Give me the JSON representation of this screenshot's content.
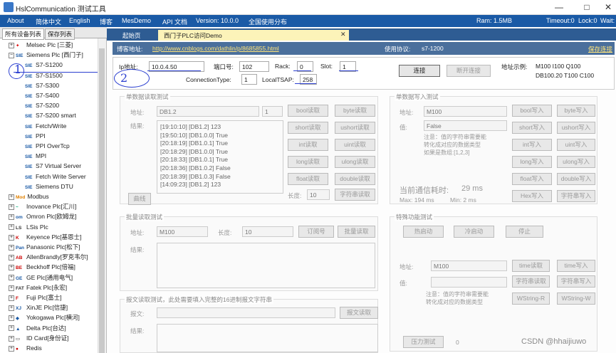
{
  "window": {
    "title": "HslCommunication 测试工具",
    "minimize": "—",
    "maximize": "□",
    "close": "✕"
  },
  "menu": {
    "items": [
      "About",
      "简体中文",
      "English",
      "博客",
      "MesDemo",
      "API 文档",
      "Version: 10.0.0",
      "全国使用分布"
    ],
    "ram": "Ram: 1.5MB",
    "timeout": "Timeout:0",
    "lock": "Lock:0",
    "wait": "Wait:"
  },
  "left_panel": {
    "tabs": [
      "所有设备列表",
      "保存列表"
    ],
    "tree": [
      {
        "icon": "mitsubishi-icon",
        "glyph": "✦",
        "label": "Melsec Plc [三菱]",
        "level": 0,
        "expander": "+"
      },
      {
        "icon": "siemens-icon",
        "glyph": "SIE",
        "label": "Siemens Plc [西门子]",
        "level": 0,
        "expander": "−"
      },
      {
        "icon": "siemens-icon",
        "glyph": "SIE",
        "label": "S7-S1200",
        "level": 1
      },
      {
        "icon": "siemens-icon",
        "glyph": "SIE",
        "label": "S7-S1500",
        "level": 1
      },
      {
        "icon": "siemens-icon",
        "glyph": "SIE",
        "label": "S7-S300",
        "level": 1
      },
      {
        "icon": "siemens-icon",
        "glyph": "SIE",
        "label": "S7-S400",
        "level": 1
      },
      {
        "icon": "siemens-icon",
        "glyph": "SIE",
        "label": "S7-S200",
        "level": 1
      },
      {
        "icon": "siemens-icon",
        "glyph": "SIE",
        "label": "S7-S200 smart",
        "level": 1
      },
      {
        "icon": "siemens-icon",
        "glyph": "SIE",
        "label": "Fetch/Write",
        "level": 1
      },
      {
        "icon": "siemens-icon",
        "glyph": "SIE",
        "label": "PPI",
        "level": 1
      },
      {
        "icon": "siemens-icon",
        "glyph": "SIE",
        "label": "PPI OverTcp",
        "level": 1
      },
      {
        "icon": "siemens-icon",
        "glyph": "SIE",
        "label": "MPI",
        "level": 1
      },
      {
        "icon": "siemens-icon",
        "glyph": "SIE",
        "label": "S7 Virtual Server",
        "level": 1
      },
      {
        "icon": "siemens-icon",
        "glyph": "SIE",
        "label": "Fetch Write Server",
        "level": 1
      },
      {
        "icon": "siemens-icon",
        "glyph": "SIE",
        "label": "Siemens DTU",
        "level": 1
      },
      {
        "icon": "modbus-icon",
        "glyph": "Mod",
        "label": "Modbus",
        "level": 0,
        "expander": "+"
      },
      {
        "icon": "inovance-icon",
        "glyph": "~",
        "label": "Inovance Plc[汇川]",
        "level": 0,
        "expander": "+"
      },
      {
        "icon": "omron-icon",
        "glyph": "om",
        "label": "Omron Plc[欧姆龙]",
        "level": 0,
        "expander": "+"
      },
      {
        "icon": "lsis-icon",
        "glyph": "LS",
        "label": "LSis Plc",
        "level": 0,
        "expander": "+"
      },
      {
        "icon": "keyence-icon",
        "glyph": "K",
        "label": "Keyence Plc[基恩士]",
        "level": 0,
        "expander": "+"
      },
      {
        "icon": "panasonic-icon",
        "glyph": "Pan",
        "label": "Panasonic Plc[松下]",
        "level": 0,
        "expander": "+"
      },
      {
        "icon": "allenbradley-icon",
        "glyph": "AB",
        "label": "AllenBrandly[罗克韦尔]",
        "level": 0,
        "expander": "+"
      },
      {
        "icon": "beckhoff-icon",
        "glyph": "BE",
        "label": "Beckhoff Plc[倍福]",
        "level": 0,
        "expander": "+"
      },
      {
        "icon": "ge-icon",
        "glyph": "GE",
        "label": "GE Plc[通用电气]",
        "level": 0,
        "expander": "+"
      },
      {
        "icon": "fatek-icon",
        "glyph": "FAT",
        "label": "Fatek Plc[永宏]",
        "level": 0,
        "expander": "+"
      },
      {
        "icon": "fuji-icon",
        "glyph": "F",
        "label": "Fuji Plc[富士]",
        "level": 0,
        "expander": "+"
      },
      {
        "icon": "xinje-icon",
        "glyph": "XJ",
        "label": "XinJE Plc[信捷]",
        "level": 0,
        "expander": "+"
      },
      {
        "icon": "yokogawa-icon",
        "glyph": "◆",
        "label": "Yokogawa Plc[横河]",
        "level": 0,
        "expander": "+"
      },
      {
        "icon": "delta-icon",
        "glyph": "▲",
        "label": "Delta Plc[台达]",
        "level": 0,
        "expander": "+"
      },
      {
        "icon": "idcard-icon",
        "glyph": "▭",
        "label": "ID Card[身份证]",
        "level": 0,
        "expander": "+"
      },
      {
        "icon": "redis-icon",
        "glyph": "●",
        "label": "Redis",
        "level": 0,
        "expander": "+"
      }
    ]
  },
  "doc_tabs": {
    "home": "起始页",
    "active": "西门子PLC访问Demo",
    "close": "✕"
  },
  "blog_bar": {
    "label": "博客地址:",
    "url": "http://www.cnblogs.com/dathlin/p/8685855.html",
    "protocol_label": "使用协议:",
    "protocol": "s7-1200",
    "save": "保存连接"
  },
  "connection": {
    "ip_label": "Ip地址:",
    "ip": "10.0.4.50",
    "port_label": "端口号:",
    "port": "102",
    "rack_label": "Rack:",
    "rack": "0",
    "slot_label": "Slot:",
    "slot": "1",
    "conntype_label": "ConnectionType:",
    "conntype": "1",
    "tsap_label": "LocalTSAP:",
    "tsap": "258",
    "connect": "连接",
    "disconnect": "断开连接",
    "example_label": "地址示例:",
    "example_line1": "M100  I100  Q100",
    "example_line2": "DB100.20  T100 C100"
  },
  "single_read": {
    "title": "单数据读取测试",
    "addr_label": "地址:",
    "addr": "DB1.2",
    "count": "1",
    "result_label": "结果:",
    "log": [
      "[19:10:10] [DB1.2] 123",
      "[19:50:10] [DB1.0.0] True",
      "[20:18:19] [DB1.0.1] True",
      "[20:18:29] [DB1.0.0] True",
      "[20:18:33] [DB1.0.1] True",
      "[20:18:36] [DB1.0.2] False",
      "[20:18:39] [DB1.0.3] False",
      "[14:09:23] [DB1.2] 123"
    ],
    "buttons": [
      "bool读取",
      "byte读取",
      "short读取",
      "ushort读取",
      "int读取",
      "uint读取",
      "long读取",
      "ulong读取",
      "float读取",
      "double读取"
    ],
    "curve": "曲线",
    "length_label": "长度:",
    "length": "10",
    "string_read": "字符串读取"
  },
  "single_write": {
    "title": "单数据写入测试",
    "addr_label": "地址:",
    "addr": "M100",
    "value_label": "值:",
    "value": "False",
    "note": [
      "注意：值的字符串需要能",
      "转化成对应的数据类型",
      "如果是数组:[1,2,3]"
    ],
    "buttons": [
      "bool写入",
      "byte写入",
      "short写入",
      "ushort写入",
      "int写入",
      "uint写入",
      "long写入",
      "ulong写入",
      "float写入",
      "double写入",
      "Hex写入",
      "字符串写入"
    ],
    "comm_label": "当前通信耗时:",
    "comm_value": "29 ms",
    "max": "Max:   194 ms",
    "min": "Min:    2 ms"
  },
  "batch_read": {
    "title": "批量读取测试",
    "addr_label": "地址:",
    "addr": "M100",
    "length_label": "长度:",
    "length": "10",
    "subscribe": "订阅号",
    "batch": "批量读取",
    "result_label": "结果:"
  },
  "message_read": {
    "title": "报文读取测试，此处需要填入完整的16进制报文字符串",
    "msg_label": "报文:",
    "read": "报文读取",
    "result_label": "结果:"
  },
  "special": {
    "title": "特殊功能测试",
    "hot": "热启动",
    "cold": "冷启动",
    "stop": "停止",
    "addr_label": "地址:",
    "addr": "M100",
    "value_label": "值:",
    "time_read": "time读取",
    "time_write": "time写入",
    "str_read": "字符串读取",
    "str_write": "字符串写入",
    "wstr_read": "WString-R",
    "wstr_write": "WString-W",
    "note": [
      "注意：值的字符串需要能",
      "转化成对应的数据类型"
    ],
    "pressure": "压力测试",
    "pressure_value": "0"
  },
  "annotations": {
    "one": "1",
    "two": "2"
  },
  "watermark": "CSDN @hhaijiuwo",
  "colors": {
    "menubar": "#1a5aa6",
    "doctabs": "#2e5c93",
    "annotation": "#2b3fd0"
  }
}
